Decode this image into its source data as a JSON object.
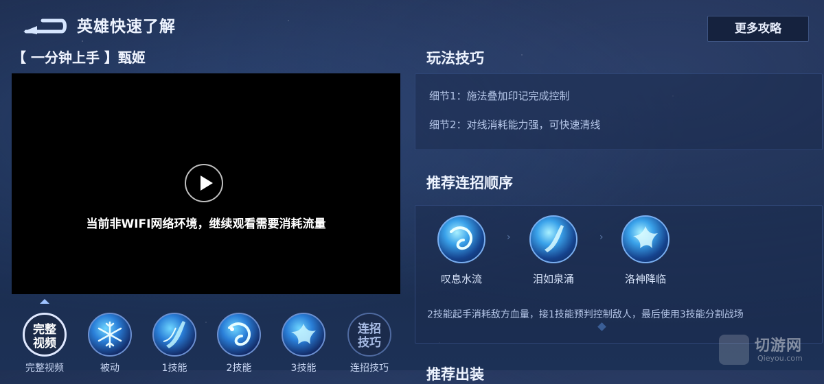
{
  "header": {
    "title": "英雄快速了解",
    "more_button": "更多攻略"
  },
  "video": {
    "title": "【 一分钟上手 】甄姬",
    "network_notice": "当前非WIFI网络环境，继续观看需要消耗流量"
  },
  "tabs": [
    {
      "label": "完整视频",
      "circle_text_line1": "完整",
      "circle_text_line2": "视频",
      "active": true
    },
    {
      "label": "被动",
      "icon": "snowflake-icon"
    },
    {
      "label": "1技能",
      "icon": "skill-1-icon"
    },
    {
      "label": "2技能",
      "icon": "skill-2-icon"
    },
    {
      "label": "3技能",
      "icon": "skill-3-icon"
    },
    {
      "label": "连招技巧",
      "circle_text_line1": "连招",
      "circle_text_line2": "技巧"
    }
  ],
  "tips": {
    "title": "玩法技巧",
    "items": [
      "细节1：施法叠加印记完成控制",
      "细节2：对线消耗能力强，可快速清线"
    ]
  },
  "combo": {
    "title": "推荐连招顺序",
    "skills": [
      {
        "name": "叹息水流"
      },
      {
        "name": "泪如泉涌"
      },
      {
        "name": "洛神降临"
      }
    ],
    "description": "2技能起手消耗敌方血量，接1技能预判控制敌人，最后使用3技能分割战场"
  },
  "bottom_section_title": "推荐出装",
  "watermark": {
    "text": "切游网",
    "sub": "Qieyou.com"
  },
  "colors": {
    "background": "#1d2c4d",
    "panel_border": "#2f4677",
    "accent_blue": "#3aa2ea"
  }
}
